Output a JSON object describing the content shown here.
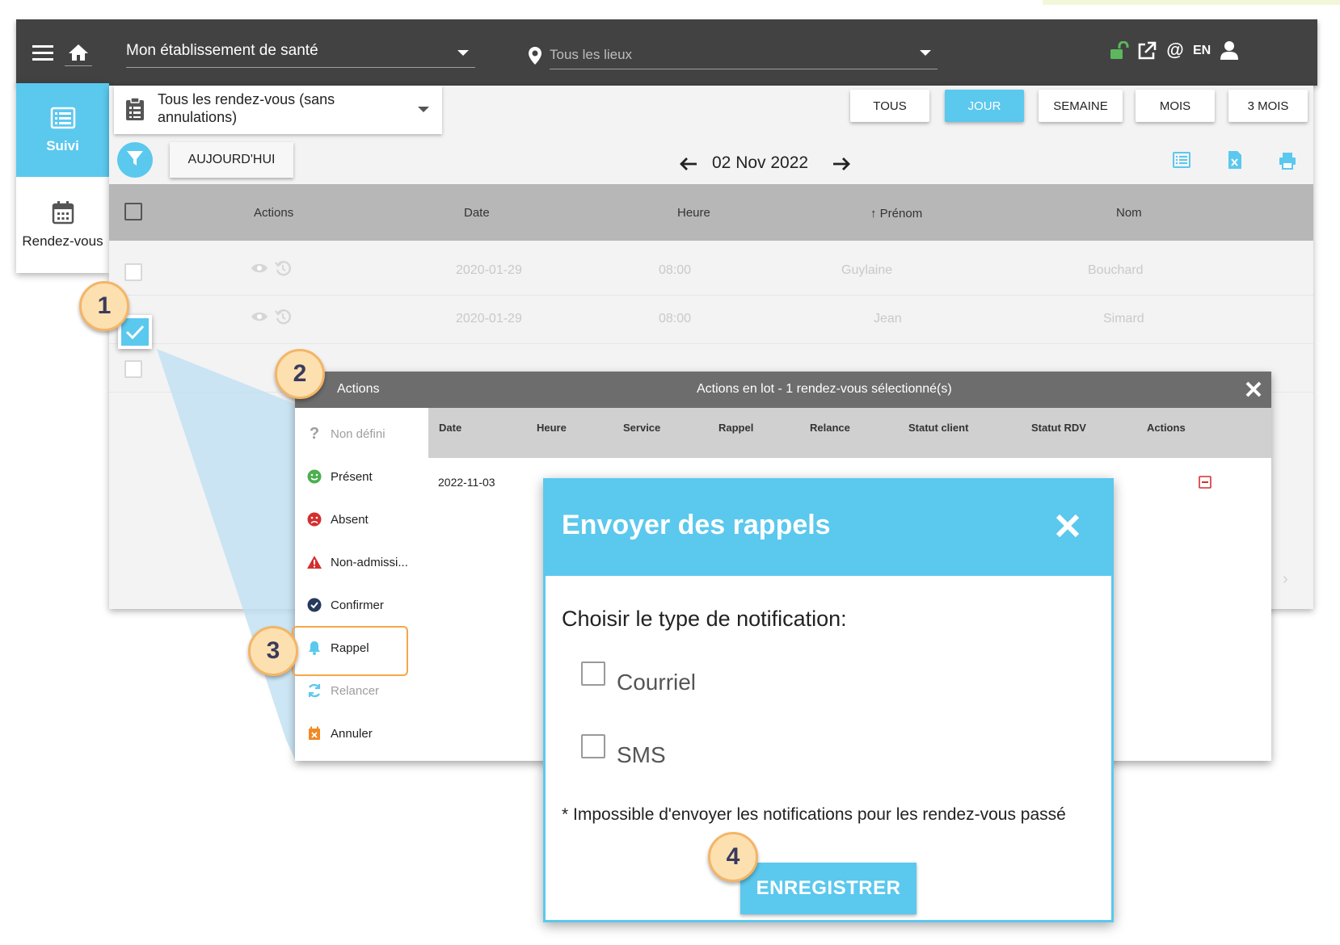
{
  "topbar": {
    "establishment": "Mon établissement de santé",
    "location_placeholder": "Tous les lieux",
    "lang": "EN",
    "icons": [
      "menu-icon",
      "home-icon",
      "map-pin-icon",
      "unlock-icon",
      "external-link-icon",
      "at-icon",
      "user-icon"
    ]
  },
  "leftnav": {
    "items": [
      {
        "label": "Suivi",
        "icon": "list-icon",
        "active": true
      },
      {
        "label": "Rendez-vous",
        "icon": "calendar-icon",
        "active": false
      }
    ]
  },
  "toolbar": {
    "filter_select": "Tous les rendez-vous (sans annulations)",
    "today_button": "AUJOURD'HUI",
    "date": "02 Nov 2022",
    "periods": [
      "TOUS",
      "JOUR",
      "SEMAINE",
      "MOIS",
      "3 MOIS"
    ],
    "active_period": "JOUR"
  },
  "table": {
    "columns": [
      "Actions",
      "Date",
      "Heure",
      "↑ Prénom",
      "Nom"
    ],
    "rows": [
      {
        "date": "2020-01-29",
        "heure": "08:00",
        "prenom": "Guylaine",
        "nom": "Bouchard",
        "checked": false
      },
      {
        "date": "2020-01-29",
        "heure": "08:00",
        "prenom": "Jean",
        "nom": "Simard",
        "checked": true
      },
      {
        "checked": false
      }
    ]
  },
  "batch": {
    "left_title": "Actions",
    "title": "Actions en lot - 1 rendez-vous sélectionné(s)",
    "side_items": [
      {
        "label": "Non défini",
        "icon": "question-icon",
        "color": "#9e9e9e"
      },
      {
        "label": "Présent",
        "icon": "smile-icon",
        "color": "#4caf50"
      },
      {
        "label": "Absent",
        "icon": "frown-icon",
        "color": "#d32f2f"
      },
      {
        "label": "Non-admissi...",
        "icon": "warning-icon",
        "color": "#d32f2f"
      },
      {
        "label": "Confirmer",
        "icon": "check-circle-icon",
        "color": "#263a5c"
      },
      {
        "label": "Rappel",
        "icon": "bell-icon",
        "color": "#5bc8ee"
      },
      {
        "label": "Relancer",
        "icon": "refresh-icon",
        "color": "#5bc8ee"
      },
      {
        "label": "Annuler",
        "icon": "calendar-x-icon",
        "color": "#f08a24"
      }
    ],
    "columns": [
      "Date",
      "Heure",
      "Service",
      "Rappel",
      "Relance",
      "Statut client",
      "Statut RDV",
      "Actions"
    ],
    "row": {
      "date": "2022-11-03"
    }
  },
  "modal": {
    "title": "Envoyer des rappels",
    "prompt": "Choisir le type de notification:",
    "options": [
      "Courriel",
      "SMS"
    ],
    "note": "* Impossible d'envoyer les notifications pour les rendez-vous passé",
    "save": "ENREGISTRER"
  },
  "badges": [
    "1",
    "2",
    "3",
    "4"
  ],
  "colors": {
    "accent": "#5bc8ee",
    "topbar": "#424242",
    "badge_fill": "#fde0b0",
    "badge_border": "#f4b566"
  }
}
